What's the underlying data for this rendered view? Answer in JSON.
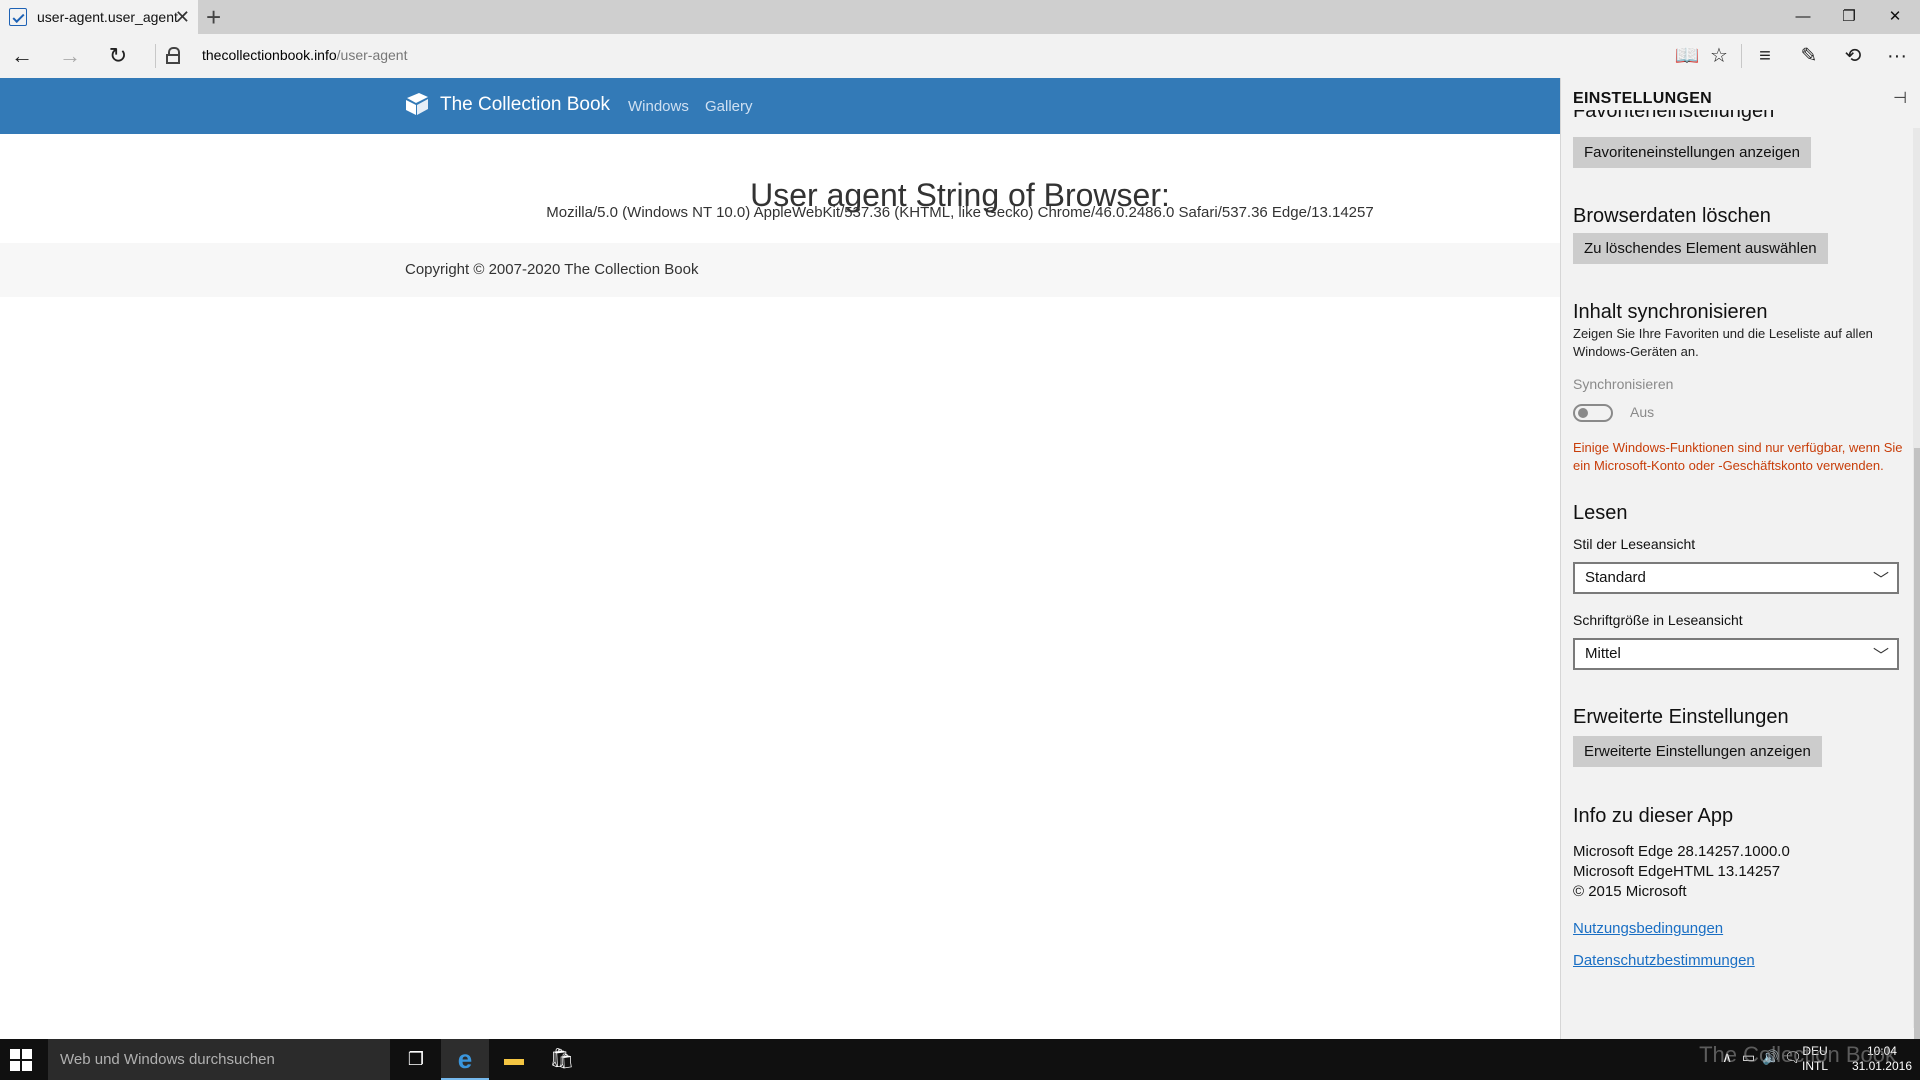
{
  "browser": {
    "tab_title": "user-agent.user_agent -",
    "tab_close": "✕",
    "new_tab": "+",
    "url_host": "thecollectionbook.info",
    "url_path": "/user-agent",
    "window_controls": {
      "minimize": "—",
      "restore": "❐",
      "close": "✕"
    },
    "nav": {
      "back": "←",
      "forward": "→",
      "refresh": "↻"
    },
    "tools": {
      "reading_view": "📖",
      "favorite": "☆",
      "hub": "≡",
      "notes": "✎",
      "share": "⟲",
      "more": "···"
    }
  },
  "site": {
    "brand": "The Collection Book",
    "nav_items": [
      "Windows",
      "Gallery"
    ],
    "heading": "User agent String of Browser:",
    "user_agent": "Mozilla/5.0 (Windows NT 10.0) AppleWebKit/537.36 (KHTML, like Gecko) Chrome/46.0.2486.0 Safari/537.36 Edge/13.14257",
    "copyright": "Copyright © 2007-2020 The Collection Book"
  },
  "settings": {
    "title": "EINSTELLUNGEN",
    "pin": "⊣",
    "favorites_heading": "Favoriteneinstellungen",
    "favorites_button": "Favoriteneinstellungen anzeigen",
    "clear_heading": "Browserdaten löschen",
    "clear_button": "Zu löschendes Element auswählen",
    "sync_heading": "Inhalt synchronisieren",
    "sync_desc": "Zeigen Sie Ihre Favoriten und die Leseliste auf allen Windows-Geräten an.",
    "sync_label": "Synchronisieren",
    "sync_state": "Aus",
    "sync_warning": "Einige Windows-Funktionen sind nur verfügbar, wenn Sie ein Microsoft-Konto oder -Geschäftskonto verwenden.",
    "read_heading": "Lesen",
    "read_style_label": "Stil der Leseansicht",
    "read_style_value": "Standard",
    "read_font_label": "Schriftgröße in Leseansicht",
    "read_font_value": "Mittel",
    "advanced_heading": "Erweiterte Einstellungen",
    "advanced_button": "Erweiterte Einstellungen anzeigen",
    "about_heading": "Info zu dieser App",
    "about_lines": [
      "Microsoft Edge 28.14257.1000.0",
      "Microsoft EdgeHTML 13.14257",
      "© 2015 Microsoft"
    ],
    "terms_link": "Nutzungsbedingungen",
    "privacy_link": "Datenschutzbestimmungen",
    "chevron": "﹀"
  },
  "taskbar": {
    "search_placeholder": "Web und Windows durchsuchen",
    "task_view": "❐",
    "edge": "e",
    "explorer": "▬",
    "store": "🛍",
    "tray_icons": [
      "∧",
      "▭",
      "🔊",
      "🗨"
    ],
    "lang_top": "DEU",
    "lang_bottom": "INTL",
    "time": "10:04",
    "date": "31.01.2016",
    "watermark": "The Collection Book"
  }
}
